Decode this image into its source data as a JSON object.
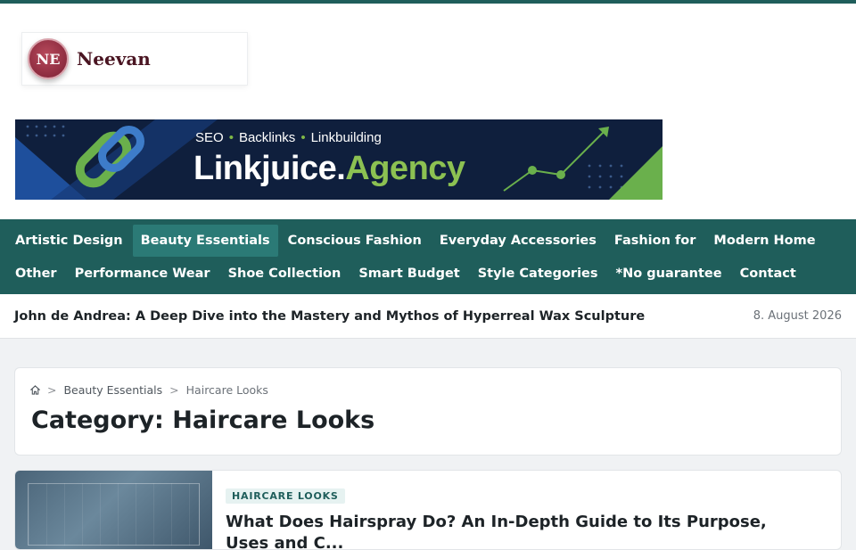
{
  "site": {
    "logo_initials": "NE",
    "logo_name": "Neevan"
  },
  "banner": {
    "tagline_1": "SEO",
    "tagline_2": "Backlinks",
    "tagline_3": "Linkbuilding",
    "title_main": "Linkjuice.",
    "title_accent": "Agency"
  },
  "nav": {
    "row1": [
      {
        "label": "Artistic Design",
        "active": false
      },
      {
        "label": "Beauty Essentials",
        "active": true
      },
      {
        "label": "Conscious Fashion",
        "active": false
      },
      {
        "label": "Everyday Accessories",
        "active": false
      },
      {
        "label": "Fashion for",
        "active": false
      },
      {
        "label": "Modern Home",
        "active": false
      }
    ],
    "row2": [
      {
        "label": "Other",
        "active": false
      },
      {
        "label": "Performance Wear",
        "active": false
      },
      {
        "label": "Shoe Collection",
        "active": false
      },
      {
        "label": "Smart Budget",
        "active": false
      },
      {
        "label": "Style Categories",
        "active": false
      },
      {
        "label": "*No guarantee",
        "active": false
      },
      {
        "label": "Contact",
        "active": false
      }
    ]
  },
  "ticker": {
    "headline": "John de Andrea: A Deep Dive into the Mastery and Mythos of Hyperreal Wax Sculpture",
    "date": "8. August 2026"
  },
  "breadcrumb": {
    "home_icon": "home-icon",
    "separator": ">",
    "level1": "Beauty Essentials",
    "level2": "Haircare Looks"
  },
  "category": {
    "title": "Category: Haircare Looks"
  },
  "post": {
    "badge": "HAIRCARE LOOKS",
    "title": "What Does Hairspray Do? An In-Depth Guide to Its Purpose, Uses and C..."
  },
  "colors": {
    "brand": "#1f5e5b",
    "nav_active": "#2b7a76",
    "banner_bg": "#0f1f3d",
    "banner_accent": "#8cc152",
    "logo_maroon": "#7a1f33"
  }
}
